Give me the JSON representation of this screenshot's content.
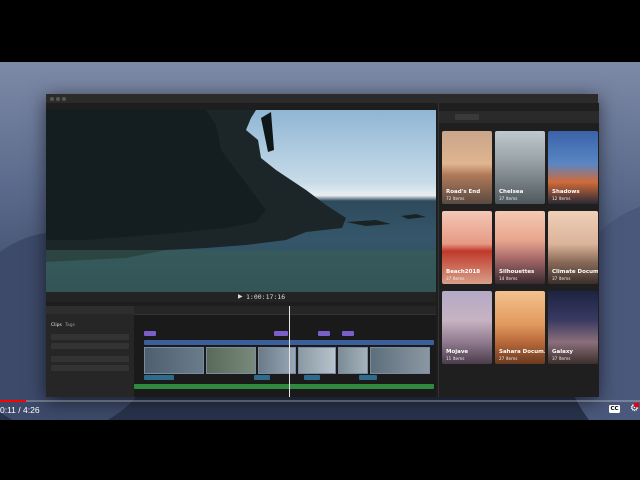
{
  "player": {
    "current_time": "0:11",
    "duration": "4:26",
    "time_display": "0:11 / 4:26",
    "progress": 0.0414,
    "cc_label": "CC",
    "accent_color": "#ff0000"
  },
  "viewer": {
    "timecode": "1:00:17:16"
  },
  "browser": {
    "tabs": [
      "Clips",
      "Tags"
    ]
  },
  "photos": {
    "albums": [
      {
        "name": "Road's End",
        "count": "72 Items"
      },
      {
        "name": "Chelsea",
        "count": "37 Items"
      },
      {
        "name": "Shadows",
        "count": "12 Items"
      },
      {
        "name": "Beach2018",
        "count": "37 Items"
      },
      {
        "name": "Silhouettes",
        "count": "14 Items"
      },
      {
        "name": "Climate Docum...",
        "count": "37 Items"
      },
      {
        "name": "Mojave",
        "count": "11 Items"
      },
      {
        "name": "Sahara Docum...",
        "count": "27 Items"
      },
      {
        "name": "Galaxy",
        "count": "37 Items"
      }
    ]
  }
}
